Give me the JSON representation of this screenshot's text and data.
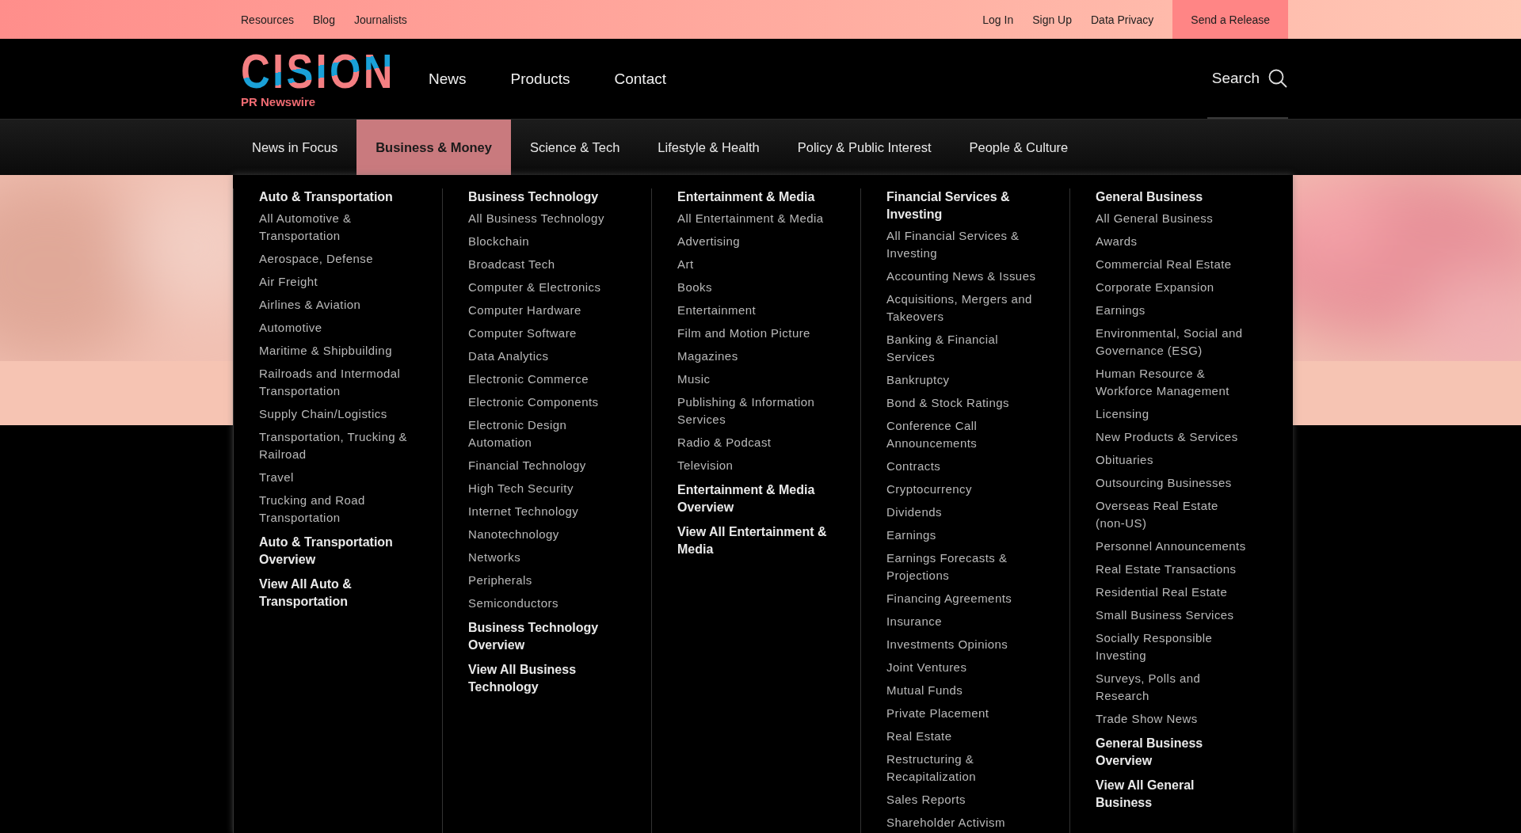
{
  "top_bar": {
    "left_links": [
      "Resources",
      "Blog",
      "Journalists"
    ],
    "right_links": [
      "Log In",
      "Sign Up",
      "Data Privacy"
    ],
    "cta": "Send a Release"
  },
  "header": {
    "logo": "CISION",
    "logo_subtitle": "PR Newswire",
    "nav": [
      "News",
      "Products",
      "Contact"
    ],
    "search": "Search"
  },
  "category_tabs": [
    {
      "label": "News in Focus",
      "selected": false
    },
    {
      "label": "Business & Money",
      "selected": true
    },
    {
      "label": "Science & Tech",
      "selected": false
    },
    {
      "label": "Lifestyle & Health",
      "selected": false
    },
    {
      "label": "Policy & Public Interest",
      "selected": false
    },
    {
      "label": "People & Culture",
      "selected": false
    }
  ],
  "mega_menu": {
    "columns": [
      {
        "heading": "Auto & Transportation",
        "items": [
          "All Automotive & Transportation",
          "Aerospace, Defense",
          "Air Freight",
          "Airlines & Aviation",
          "Automotive",
          "Maritime & Shipbuilding",
          "Railroads and Intermodal Transportation",
          "Supply Chain/Logistics",
          "Transportation, Trucking & Railroad",
          "Travel",
          "Trucking and Road Transportation"
        ],
        "footer_links": [
          "Auto & Transportation Overview",
          "View All Auto & Transportation"
        ]
      },
      {
        "heading": "Business Technology",
        "items": [
          "All Business Technology",
          "Blockchain",
          "Broadcast Tech",
          "Computer & Electronics",
          "Computer Hardware",
          "Computer Software",
          "Data Analytics",
          "Electronic Commerce",
          "Electronic Components",
          "Electronic Design Automation",
          "Financial Technology",
          "High Tech Security",
          "Internet Technology",
          "Nanotechnology",
          "Networks",
          "Peripherals",
          "Semiconductors"
        ],
        "footer_links": [
          "Business Technology Overview",
          "View All Business Technology"
        ]
      },
      {
        "heading": "Entertainment & Media",
        "items": [
          "All Entertainment & Media",
          "Advertising",
          "Art",
          "Books",
          "Entertainment",
          "Film and Motion Picture",
          "Magazines",
          "Music",
          "Publishing & Information Services",
          "Radio & Podcast",
          "Television"
        ],
        "footer_links": [
          "Entertainment & Media Overview",
          "View All Entertainment & Media"
        ]
      },
      {
        "heading": "Financial Services & Investing",
        "items": [
          "All Financial Services & Investing",
          "Accounting News & Issues",
          "Acquisitions, Mergers and Takeovers",
          "Banking & Financial Services",
          "Bankruptcy",
          "Bond & Stock Ratings",
          "Conference Call Announcements",
          "Contracts",
          "Cryptocurrency",
          "Dividends",
          "Earnings",
          "Earnings Forecasts & Projections",
          "Financing Agreements",
          "Insurance",
          "Investments Opinions",
          "Joint Ventures",
          "Mutual Funds",
          "Private Placement",
          "Real Estate",
          "Restructuring & Recapitalization",
          "Sales Reports",
          "Shareholder Activism"
        ]
      },
      {
        "heading": "General Business",
        "items": [
          "All General Business",
          "Awards",
          "Commercial Real Estate",
          "Corporate Expansion",
          "Earnings",
          "Environmental, Social and Governance (ESG)",
          "Human Resource & Workforce Management",
          "Licensing",
          "New Products & Services",
          "Obituaries",
          "Outsourcing Businesses",
          "Overseas Real Estate (non-US)",
          "Personnel Announcements",
          "Real Estate Transactions",
          "Residential Real Estate",
          "Small Business Services",
          "Socially Responsible Investing",
          "Surveys, Polls and Research",
          "Trade Show News"
        ],
        "footer_links": [
          "General Business Overview",
          "View All General Business"
        ]
      }
    ]
  }
}
